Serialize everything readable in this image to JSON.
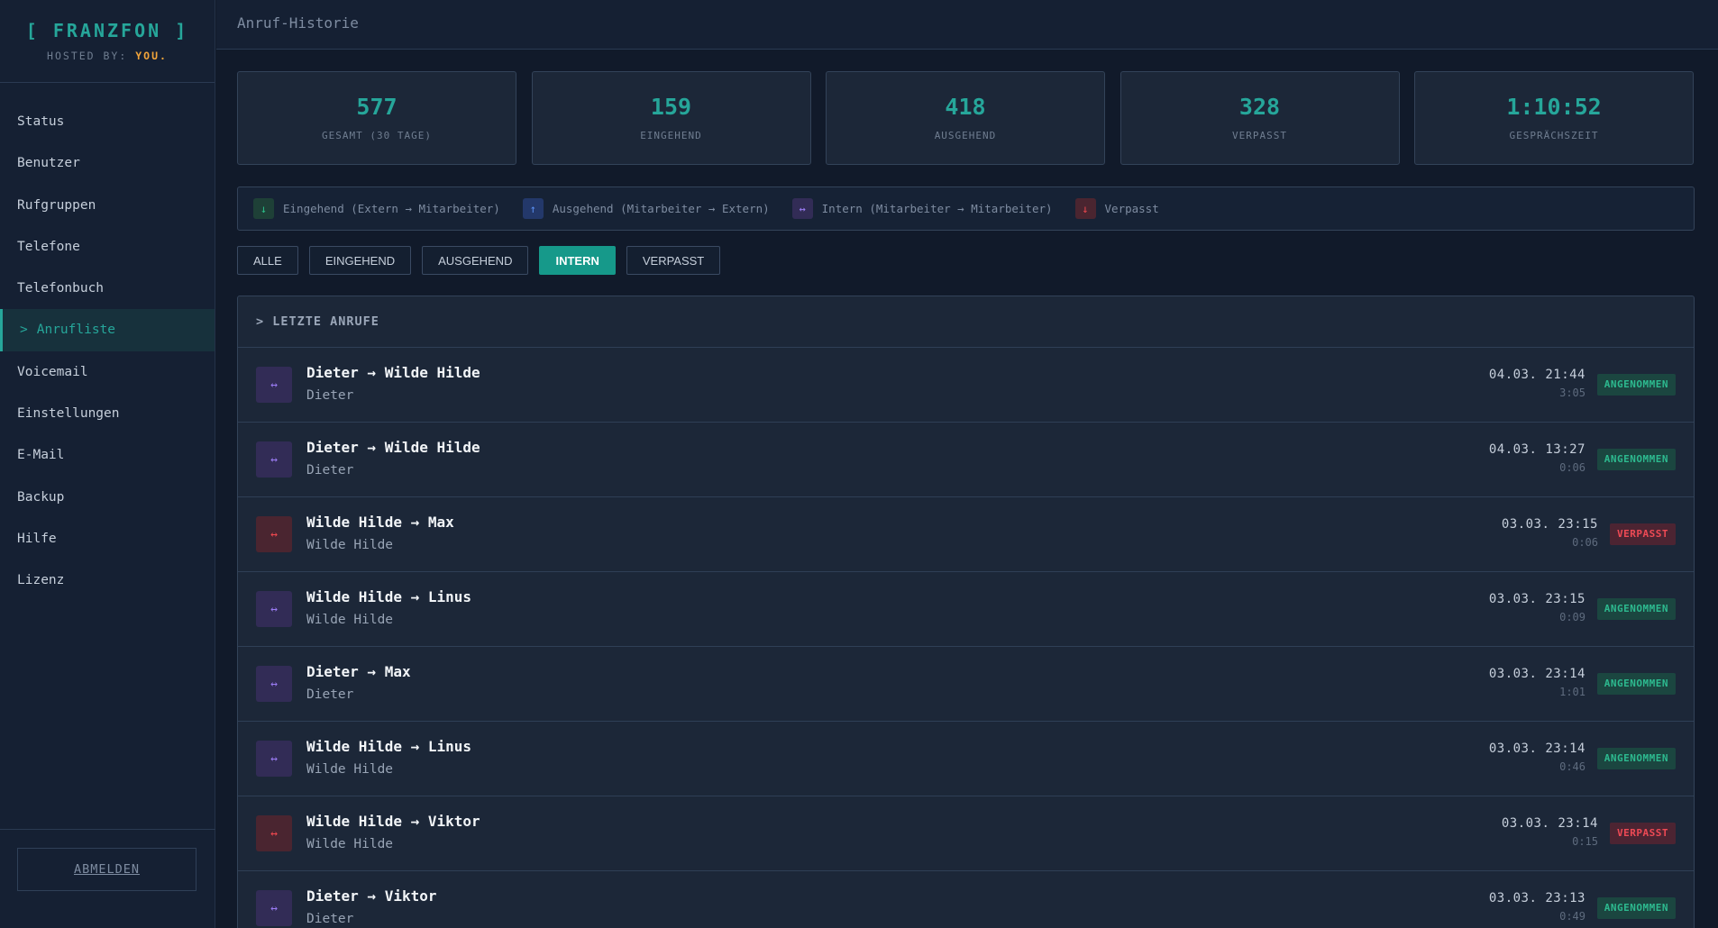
{
  "brand": {
    "title": "[ FRANZFON ]",
    "hosted_prefix": "HOSTED BY:",
    "hosted_name": "YOU",
    "hosted_suffix": "."
  },
  "nav": [
    {
      "label": "Status"
    },
    {
      "label": "Benutzer"
    },
    {
      "label": "Rufgruppen"
    },
    {
      "label": "Telefone"
    },
    {
      "label": "Telefonbuch"
    },
    {
      "label": "Anrufliste",
      "active": true,
      "marker": ">"
    },
    {
      "label": "Voicemail"
    },
    {
      "label": "Einstellungen"
    },
    {
      "label": "E-Mail"
    },
    {
      "label": "Backup"
    },
    {
      "label": "Hilfe"
    },
    {
      "label": "Lizenz"
    }
  ],
  "logout_label": "ABMELDEN",
  "page_title": "Anruf-Historie",
  "stats": [
    {
      "value": "577",
      "label": "GESAMT (30 TAGE)"
    },
    {
      "value": "159",
      "label": "EINGEHEND"
    },
    {
      "value": "418",
      "label": "AUSGEHEND"
    },
    {
      "value": "328",
      "label": "VERPASST"
    },
    {
      "value": "1:10:52",
      "label": "GESPRÄCHSZEIT"
    }
  ],
  "legend": [
    {
      "icon": "arrow-down-icon",
      "glyph": "↓",
      "kind": "in",
      "label": "Eingehend (Extern → Mitarbeiter)"
    },
    {
      "icon": "arrow-up-icon",
      "glyph": "↑",
      "kind": "out",
      "label": "Ausgehend (Mitarbeiter → Extern)"
    },
    {
      "icon": "arrow-both-icon",
      "glyph": "↔",
      "kind": "intern",
      "label": "Intern (Mitarbeiter → Mitarbeiter)"
    },
    {
      "icon": "arrow-down-icon",
      "glyph": "↓",
      "kind": "missed",
      "label": "Verpasst"
    }
  ],
  "filters": [
    {
      "label": "ALLE"
    },
    {
      "label": "EINGEHEND"
    },
    {
      "label": "AUSGEHEND"
    },
    {
      "label": "INTERN",
      "active": true
    },
    {
      "label": "VERPASST"
    }
  ],
  "calls_header": "> LETZTE ANRUFE",
  "calls": [
    {
      "title": "Dieter → Wilde Hilde",
      "sub": "Dieter",
      "time": "04.03. 21:44",
      "duration": "3:05",
      "status": "ANGENOMMEN",
      "missed": false
    },
    {
      "title": "Dieter → Wilde Hilde",
      "sub": "Dieter",
      "time": "04.03. 13:27",
      "duration": "0:06",
      "status": "ANGENOMMEN",
      "missed": false
    },
    {
      "title": "Wilde Hilde → Max",
      "sub": "Wilde Hilde",
      "time": "03.03. 23:15",
      "duration": "0:06",
      "status": "VERPASST",
      "missed": true
    },
    {
      "title": "Wilde Hilde → Linus",
      "sub": "Wilde Hilde",
      "time": "03.03. 23:15",
      "duration": "0:09",
      "status": "ANGENOMMEN",
      "missed": false
    },
    {
      "title": "Dieter → Max",
      "sub": "Dieter",
      "time": "03.03. 23:14",
      "duration": "1:01",
      "status": "ANGENOMMEN",
      "missed": false
    },
    {
      "title": "Wilde Hilde → Linus",
      "sub": "Wilde Hilde",
      "time": "03.03. 23:14",
      "duration": "0:46",
      "status": "ANGENOMMEN",
      "missed": false
    },
    {
      "title": "Wilde Hilde → Viktor",
      "sub": "Wilde Hilde",
      "time": "03.03. 23:14",
      "duration": "0:15",
      "status": "VERPASST",
      "missed": true
    },
    {
      "title": "Dieter → Viktor",
      "sub": "Dieter",
      "time": "03.03. 23:13",
      "duration": "0:49",
      "status": "ANGENOMMEN",
      "missed": false
    }
  ],
  "call_icon": {
    "name": "arrow-both-icon",
    "glyph": "↔"
  },
  "colors": {
    "accent": "#26a69a",
    "missed": "#ef4a55",
    "intern": "#9b7cf4",
    "brand_you": "#f3a53a"
  }
}
